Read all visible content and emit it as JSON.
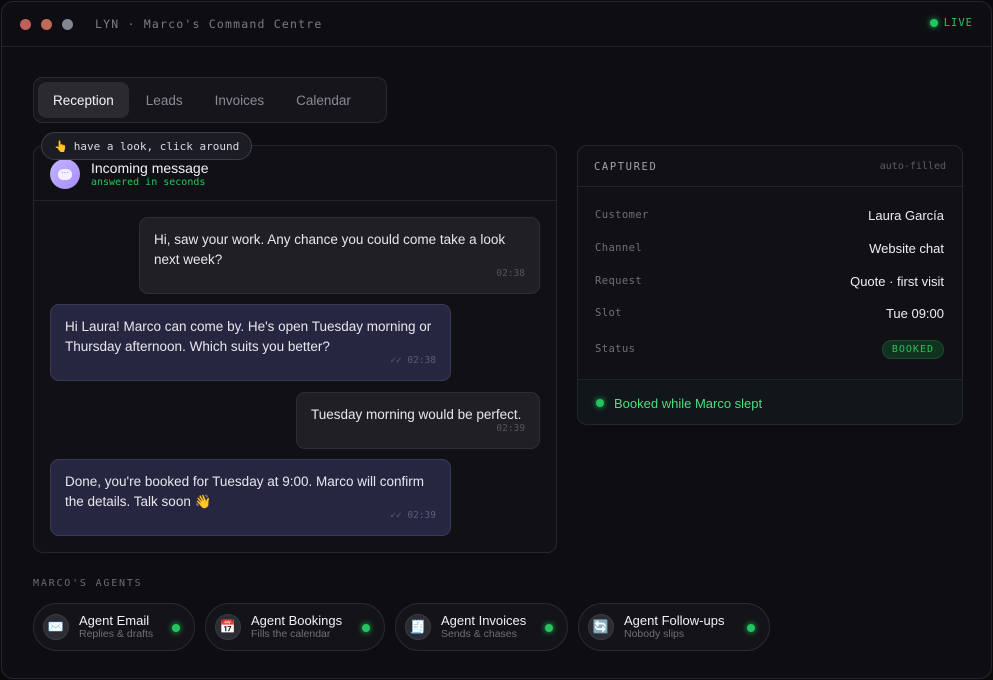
{
  "window": {
    "title": "LYN · Marco's Command Centre",
    "live_label": "LIVE",
    "dot_colors": [
      "#c0605c",
      "#c06a5a",
      "#808790"
    ]
  },
  "tabs": [
    {
      "label": "Reception",
      "active": true
    },
    {
      "label": "Leads",
      "active": false
    },
    {
      "label": "Invoices",
      "active": false
    },
    {
      "label": "Calendar",
      "active": false
    }
  ],
  "hint": {
    "emoji": "👆",
    "text": "have a look, click around"
  },
  "chat": {
    "title": "Incoming message",
    "subtitle": "answered in seconds",
    "avatar_icon": "chat-bubble-icon",
    "messages": [
      {
        "from": "customer",
        "text": "Hi, saw your work. Any chance you could come take a look next week?",
        "time": "02:38"
      },
      {
        "from": "agent",
        "text": "Hi Laura! Marco can come by. He's open Tuesday morning or Thursday afternoon. Which suits you better?",
        "time": "✓✓ 02:38"
      },
      {
        "from": "customer",
        "text": "Tuesday morning would be perfect.",
        "time": "02:39"
      },
      {
        "from": "agent",
        "text": "Done, you're booked for Tuesday at 9:00. Marco will confirm the details. Talk soon 👋",
        "time": "✓✓ 02:39"
      }
    ]
  },
  "captured": {
    "title": "CAPTURED",
    "auto": "auto-filled",
    "fields": [
      {
        "key": "Customer",
        "value": "Laura García"
      },
      {
        "key": "Channel",
        "value": "Website chat"
      },
      {
        "key": "Request",
        "value": "Quote · first visit"
      },
      {
        "key": "Slot",
        "value": "Tue 09:00"
      }
    ],
    "status_key": "Status",
    "status_value": "BOOKED",
    "footer": "Booked while Marco slept"
  },
  "agents": {
    "label": "MARCO'S AGENTS",
    "items": [
      {
        "name": "Agent Email",
        "sub": "Replies & drafts",
        "icon": "✉️",
        "icon_name": "envelope-icon"
      },
      {
        "name": "Agent Bookings",
        "sub": "Fills the calendar",
        "icon": "📅",
        "icon_name": "calendar-icon"
      },
      {
        "name": "Agent Invoices",
        "sub": "Sends & chases",
        "icon": "🧾",
        "icon_name": "receipt-icon"
      },
      {
        "name": "Agent Follow-ups",
        "sub": "Nobody slips",
        "icon": "🔄",
        "icon_name": "repeat-icon"
      }
    ]
  },
  "colors": {
    "accent_green": "#22c55e",
    "agent_bubble": "#262640",
    "customer_bubble": "#1f1f24"
  }
}
